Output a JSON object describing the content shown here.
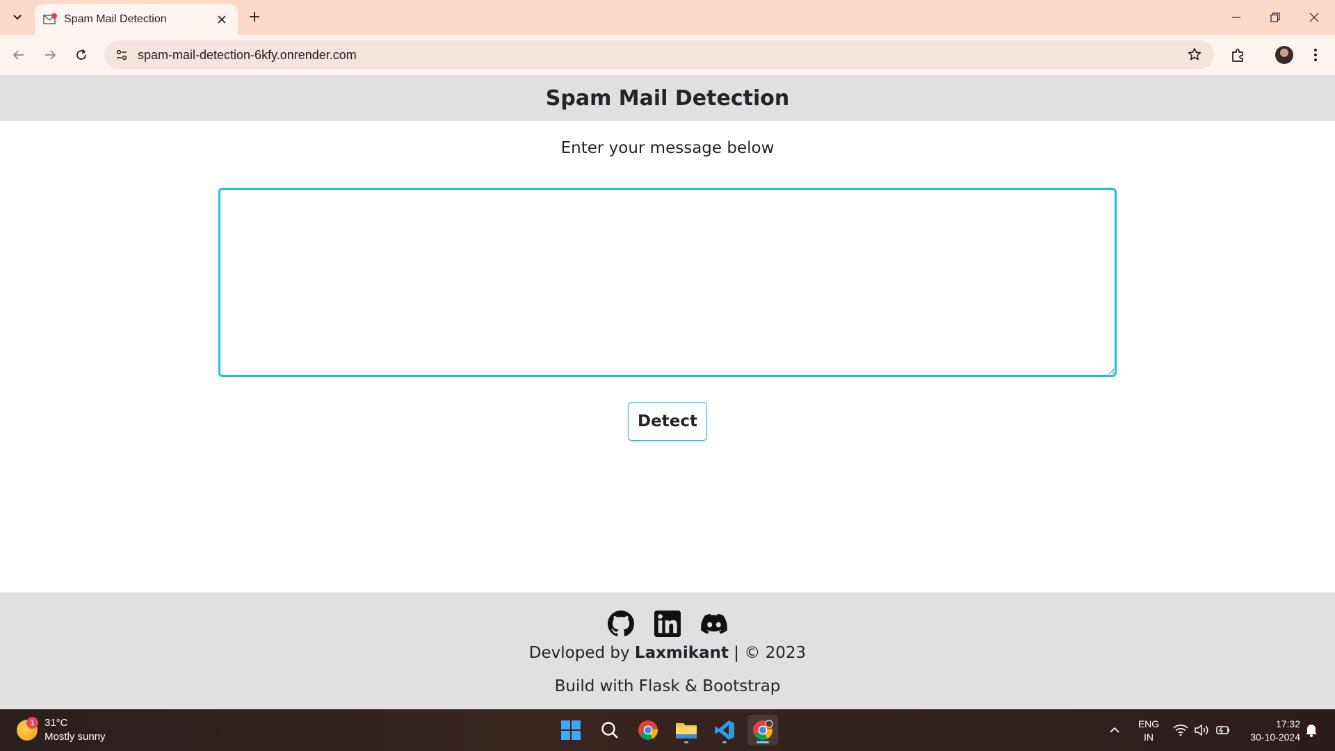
{
  "browser": {
    "tab_title": "Spam Mail Detection",
    "url": "spam-mail-detection-6kfy.onrender.com",
    "colors": {
      "tabbar": "#fdd9c9",
      "toolbar": "#fff4ef",
      "omnibox": "#f5e4dc"
    }
  },
  "page": {
    "header_title": "Spam Mail Detection",
    "prompt": "Enter your message below",
    "textarea_value": "",
    "detect_label": "Detect",
    "accent_color": "#1fc3d9",
    "footer": {
      "social_icons": [
        "github-icon",
        "linkedin-icon",
        "discord-icon"
      ],
      "credit_prefix": "Devloped by ",
      "credit_name": "Laxmikant",
      "credit_suffix": " | © 2023",
      "built_with": "Build with Flask & Bootstrap"
    }
  },
  "taskbar": {
    "weather_badge": "1",
    "temperature": "31°C",
    "condition": "Mostly sunny",
    "lang_line1": "ENG",
    "lang_line2": "IN",
    "time": "17:32",
    "date": "30-10-2024",
    "apps": [
      "windows-start-icon",
      "search-icon",
      "chrome-icon",
      "file-explorer-icon",
      "vscode-icon",
      "chrome-profile-icon"
    ]
  }
}
